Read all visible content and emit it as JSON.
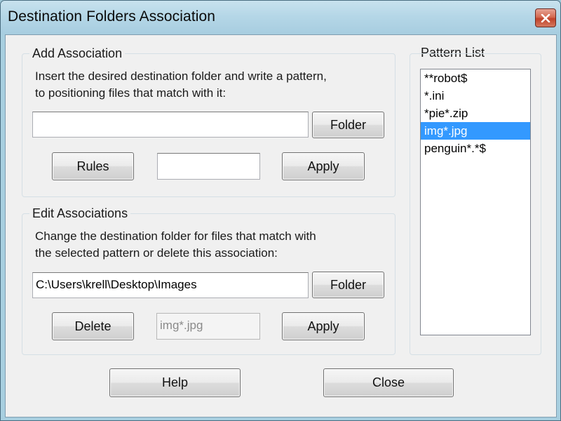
{
  "window": {
    "title": "Destination Folders Association"
  },
  "add_association": {
    "group_title": "Add Association",
    "instruction_line1": "Insert the desired destination folder and write a pattern,",
    "instruction_line2": "to positioning files that match with it:",
    "folder_input_value": "",
    "folder_button": "Folder",
    "rules_button": "Rules",
    "pattern_input_value": "",
    "apply_button": "Apply"
  },
  "edit_associations": {
    "group_title": "Edit Associations",
    "instruction_line1": "Change the destination folder for files that match with",
    "instruction_line2": "the selected pattern or delete this association:",
    "folder_input_value": "C:\\Users\\krell\\Desktop\\Images",
    "folder_button": "Folder",
    "delete_button": "Delete",
    "pattern_input_value": "img*.jpg",
    "apply_button": "Apply"
  },
  "pattern_list": {
    "group_title": "Pattern List",
    "items": [
      "**robot$",
      "*.ini",
      "*pie*.zip",
      "img*.jpg",
      "penguin*.*$"
    ],
    "selected_index": 3
  },
  "footer": {
    "help_button": "Help",
    "close_button": "Close"
  },
  "colors": {
    "selection": "#3399ff",
    "close_button": "#c8452d",
    "titlebar": "#b5d7e7"
  },
  "icons": {
    "close": "close-icon"
  }
}
